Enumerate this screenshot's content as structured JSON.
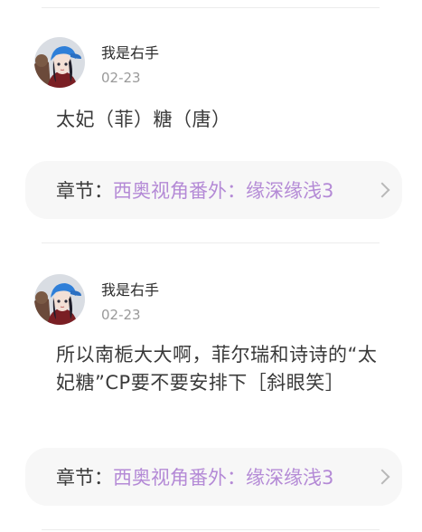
{
  "comments": [
    {
      "username": "我是右手",
      "date": "02-23",
      "text": "太妃（菲）糖（唐）",
      "chapter_prefix": "章节：",
      "chapter_title": "西奥视角番外：缘深缘浅3"
    },
    {
      "username": "我是右手",
      "date": "02-23",
      "text": "所以南栀大大啊，菲尔瑞和诗诗的“太妃糖”CP要不要安排下［斜眼笑］",
      "chapter_prefix": "章节：",
      "chapter_title": "西奥视角番外：缘深缘浅3"
    }
  ],
  "icons": {
    "avatar": "avatar-icon",
    "chevron": "chevron-right-icon"
  },
  "colors": {
    "chapter_title": "#b48ad6",
    "card_background": "#f7f7f7",
    "date": "#9a9a9a"
  }
}
